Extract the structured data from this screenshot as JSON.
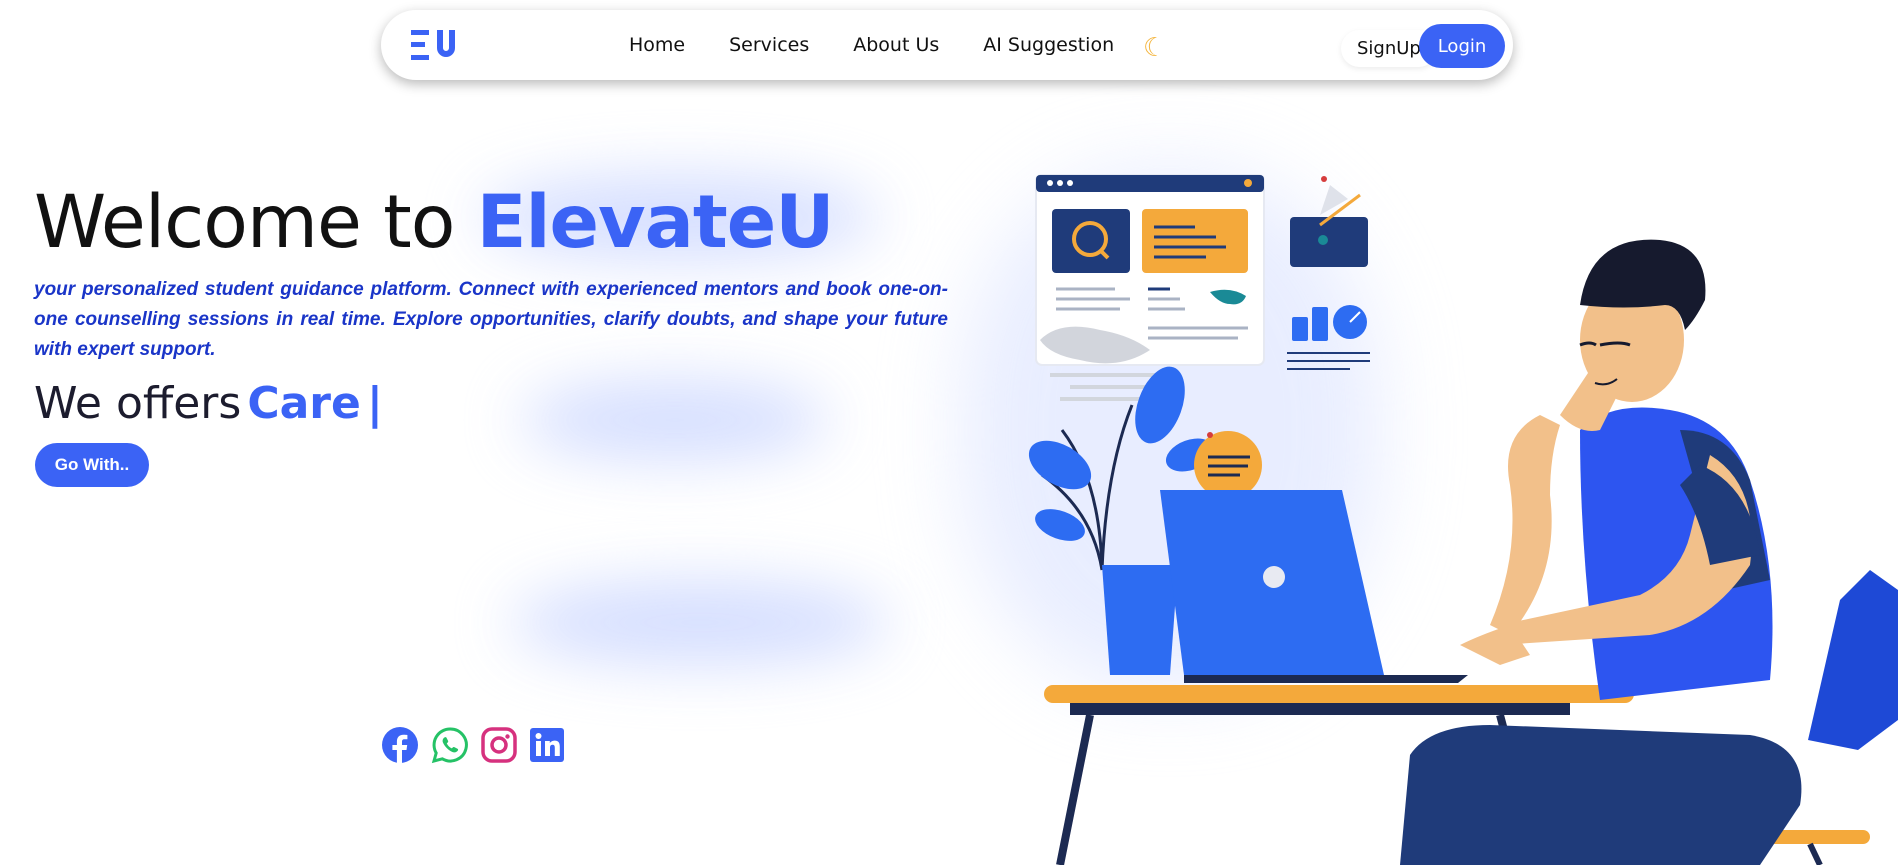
{
  "nav": {
    "logo_alt": "EU",
    "links": [
      "Home",
      "Services",
      "About Us",
      "AI Suggestion"
    ],
    "theme_icon": "moon-icon",
    "signup_label": "SignUp",
    "login_label": "Login"
  },
  "hero": {
    "title_prefix": "Welcome to ",
    "title_brand": "ElevateU",
    "description": "your personalized student guidance platform. Connect with experienced mentors and book one-on-one counselling sessions in real time. Explore opportunities, clarify doubts, and shape your future with expert support.",
    "offers_prefix": "We offers",
    "offers_word": "Care",
    "cta_label": "Go With.."
  },
  "social": [
    "facebook-icon",
    "whatsapp-icon",
    "instagram-icon",
    "linkedin-icon"
  ],
  "colors": {
    "accent": "#3b63f5",
    "description": "#1a35c8",
    "whatsapp": "#25c266",
    "instagram": "#d6317e"
  }
}
